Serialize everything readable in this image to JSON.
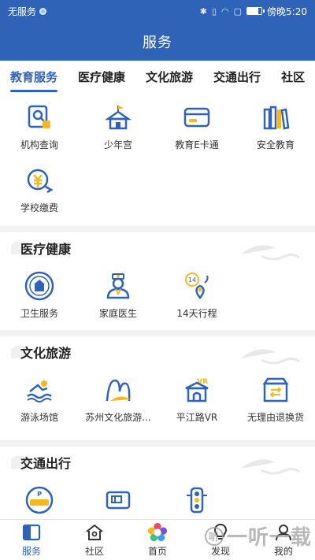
{
  "statusbar": {
    "carrier": "无服务",
    "time": "傍晚5:20",
    "battery_level": 0.8
  },
  "header": {
    "title": "服务"
  },
  "tabs": [
    {
      "label": "教育服务",
      "active": true
    },
    {
      "label": "医疗健康",
      "active": false
    },
    {
      "label": "文化旅游",
      "active": false
    },
    {
      "label": "交通出行",
      "active": false
    },
    {
      "label": "社区",
      "active": false
    }
  ],
  "education": {
    "items": [
      {
        "label": "机构查询",
        "icon": "search-institution-icon"
      },
      {
        "label": "少年宫",
        "icon": "youth-palace-icon"
      },
      {
        "label": "教育E卡通",
        "icon": "card-icon"
      },
      {
        "label": "安全教育",
        "icon": "books-icon"
      },
      {
        "label": "学校缴费",
        "icon": "payment-icon"
      }
    ]
  },
  "medical": {
    "title": "医疗健康",
    "items": [
      {
        "label": "卫生服务",
        "icon": "health-emblem-icon"
      },
      {
        "label": "家庭医生",
        "icon": "doctor-icon"
      },
      {
        "label": "14天行程",
        "icon": "trip-14-days-icon"
      }
    ]
  },
  "culture": {
    "title": "文化旅游",
    "items": [
      {
        "label": "游泳场馆",
        "icon": "swimmer-icon"
      },
      {
        "label": "苏州文化旅游...",
        "icon": "suzhou-culture-icon"
      },
      {
        "label": "平江路VR",
        "icon": "vr-gate-icon"
      },
      {
        "label": "无理由退换货",
        "icon": "return-box-icon"
      }
    ]
  },
  "transport": {
    "title": "交通出行",
    "items": [
      {
        "label": "",
        "icon": "parking-icon"
      },
      {
        "label": "",
        "icon": "transit-card-icon"
      },
      {
        "label": "",
        "icon": "traffic-light-icon"
      }
    ]
  },
  "bottom_nav": [
    {
      "label": "服务",
      "icon": "service-tab-icon",
      "active": true
    },
    {
      "label": "社区",
      "icon": "community-tab-icon",
      "active": false
    },
    {
      "label": "首页",
      "icon": "home-tab-icon",
      "active": false
    },
    {
      "label": "发现",
      "icon": "discover-tab-icon",
      "active": false
    },
    {
      "label": "我的",
      "icon": "profile-tab-icon",
      "active": false
    }
  ],
  "brand_watermark": "一听一载",
  "colors": {
    "primary": "#2f63b8",
    "accent": "#f5b81e",
    "background": "#f2f2f2"
  }
}
